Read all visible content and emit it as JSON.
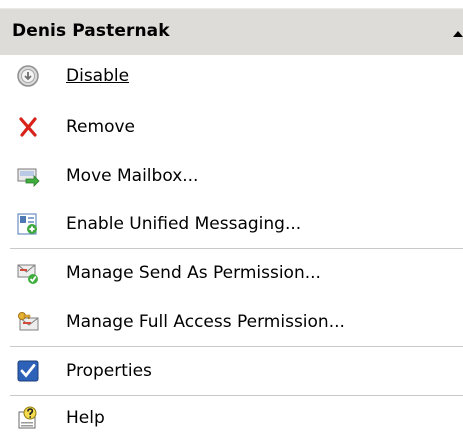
{
  "header": {
    "title": "Denis Pasternak"
  },
  "actions": [
    {
      "label": "Disable",
      "icon": "disable-icon"
    },
    {
      "label": "Remove",
      "icon": "remove-x-icon"
    },
    {
      "label": "Move Mailbox...",
      "icon": "move-mailbox-icon"
    },
    {
      "label": "Enable Unified Messaging...",
      "icon": "unified-messaging-icon"
    },
    {
      "label": "Manage Send As Permission...",
      "icon": "send-as-permission-icon"
    },
    {
      "label": "Manage Full Access Permission...",
      "icon": "full-access-permission-icon"
    },
    {
      "label": "Properties",
      "icon": "properties-checkbox-icon"
    },
    {
      "label": "Help",
      "icon": "help-icon"
    }
  ],
  "colors": {
    "header_bg": "#dedcd8",
    "divider": "#c9c9c9",
    "remove_red": "#d8231b",
    "check_blue": "#2e62b8"
  }
}
